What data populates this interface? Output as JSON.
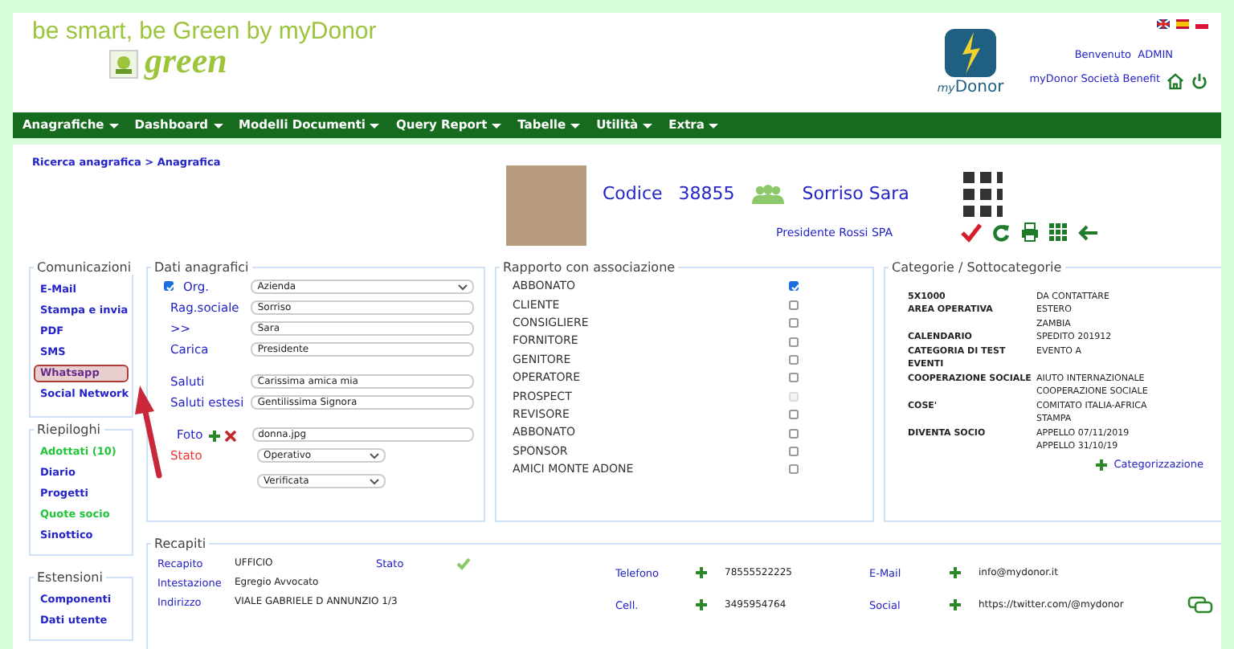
{
  "header": {
    "tagline": "be smart, be Green by myDonor",
    "logo_word": "green",
    "brand_prefix": "my",
    "brand": "Donor",
    "welcome": "Benvenuto",
    "user": "ADMIN",
    "company": "myDonor Società Benefit"
  },
  "menu": [
    {
      "label": "Anagrafiche"
    },
    {
      "label": "Dashboard"
    },
    {
      "label": "Modelli Documenti"
    },
    {
      "label": "Query Report"
    },
    {
      "label": "Tabelle"
    },
    {
      "label": "Utilità"
    },
    {
      "label": "Extra"
    }
  ],
  "breadcrumb": "Ricerca anagrafica > Anagrafica",
  "profile": {
    "code_label": "Codice",
    "code": "38855",
    "name": "Sorriso Sara",
    "role": "Presidente Rossi SPA"
  },
  "sidebar": [
    {
      "title": "Comunicazioni",
      "items": [
        {
          "label": "E-Mail",
          "color": "#2323c8",
          "highlighted": false
        },
        {
          "label": "Stampa e invia",
          "color": "#2323c8",
          "highlighted": false
        },
        {
          "label": "PDF",
          "color": "#2323c8",
          "highlighted": false
        },
        {
          "label": "SMS",
          "color": "#2323c8",
          "highlighted": false
        },
        {
          "label": "Whatsapp",
          "color": "#6a2a8a",
          "highlighted": true
        },
        {
          "label": "Social Network",
          "color": "#2323c8",
          "highlighted": false
        }
      ]
    },
    {
      "title": "Riepiloghi",
      "items": [
        {
          "label": "Adottati (10)",
          "color": "#22c43a",
          "highlighted": false
        },
        {
          "label": "Diario",
          "color": "#2323c8",
          "highlighted": false
        },
        {
          "label": "Progetti",
          "color": "#2323c8",
          "highlighted": false
        },
        {
          "label": "Quote socio",
          "color": "#22c43a",
          "highlighted": false
        },
        {
          "label": "Sinottico",
          "color": "#2323c8",
          "highlighted": false
        }
      ]
    },
    {
      "title": "Estensioni",
      "items": [
        {
          "label": "Componenti",
          "color": "#2323c8",
          "highlighted": false
        },
        {
          "label": "Dati utente",
          "color": "#2323c8",
          "highlighted": false
        }
      ]
    }
  ],
  "anagrafici": {
    "title": "Dati anagrafici",
    "fields": [
      {
        "kind": "check-select",
        "label": "Org.",
        "checked": true,
        "value": "Azienda"
      },
      {
        "kind": "text",
        "label": "Rag.sociale",
        "value": "Sorriso"
      },
      {
        "kind": "text",
        "label": ">>",
        "value": "Sara"
      },
      {
        "kind": "text",
        "label": "Carica",
        "value": "Presidente"
      },
      {
        "kind": "text",
        "label": "Saluti",
        "value": "Carissima amica mia"
      },
      {
        "kind": "text",
        "label": "Saluti estesi",
        "value": "Gentilissima Signora"
      },
      {
        "kind": "photo",
        "label": "Foto",
        "value": "donna.jpg"
      },
      {
        "kind": "status",
        "label": "Stato",
        "value": "Operativo"
      },
      {
        "kind": "select",
        "value": "Verificata"
      }
    ]
  },
  "rapporto": {
    "title": "Rapporto con associazione",
    "items": [
      {
        "label": "ABBONATO",
        "checked": true,
        "disabled": false
      },
      {
        "label": "CLIENTE",
        "checked": false,
        "disabled": false
      },
      {
        "label": "CONSIGLIERE",
        "checked": false,
        "disabled": false
      },
      {
        "label": "FORNITORE",
        "checked": false,
        "disabled": false
      },
      {
        "label": "GENITORE",
        "checked": false,
        "disabled": false
      },
      {
        "label": "OPERATORE",
        "checked": false,
        "disabled": false
      },
      {
        "label": "PROSPECT",
        "checked": false,
        "disabled": true
      },
      {
        "label": "REVISORE",
        "checked": false,
        "disabled": false
      },
      {
        "label": "ABBONATO",
        "checked": false,
        "disabled": false
      },
      {
        "label": "SPONSOR",
        "checked": false,
        "disabled": false
      },
      {
        "label": "AMICI MONTE ADONE",
        "checked": false,
        "disabled": false
      }
    ]
  },
  "categorie": {
    "title": "Categorie / Sottocategorie",
    "rows": [
      {
        "name": "5X1000",
        "values": [
          "DA CONTATTARE"
        ]
      },
      {
        "name": "AREA OPERATIVA",
        "values": [
          "ESTERO",
          "ZAMBIA"
        ]
      },
      {
        "name": "CALENDARIO",
        "values": [
          "SPEDITO 201912"
        ]
      },
      {
        "name": "CATEGORIA DI TEST EVENTI",
        "values": [
          "EVENTO A"
        ]
      },
      {
        "name": "COOPERAZIONE SOCIALE",
        "values": [
          "AIUTO INTERNAZIONALE",
          "COOPERAZIONE SOCIALE"
        ]
      },
      {
        "name": "COSE'",
        "values": [
          "COMITATO ITALIA-AFRICA",
          "STAMPA"
        ]
      },
      {
        "name": "DIVENTA SOCIO",
        "values": [
          "APPELLO 07/11/2019",
          "APPELLO 31/10/19"
        ]
      }
    ],
    "action": "Categorizzazione"
  },
  "recapiti": {
    "title": "Recapiti",
    "rows": [
      {
        "label": "Recapito",
        "value": "UFFICIO"
      },
      {
        "label": "Intestazione",
        "value": "Egregio Avvocato"
      },
      {
        "label": "Indirizzo",
        "value": "VIALE GABRIELE D ANNUNZIO 1/3"
      }
    ],
    "status_label": "Stato",
    "status_ok": true,
    "contacts": [
      {
        "label": "Telefono",
        "value": "78555522225"
      },
      {
        "label": "E-Mail",
        "value": "info@mydonor.it"
      },
      {
        "label": "Cell.",
        "value": "3495954764"
      },
      {
        "label": "Social",
        "value": "https://twitter.com/@mydonor"
      }
    ]
  }
}
